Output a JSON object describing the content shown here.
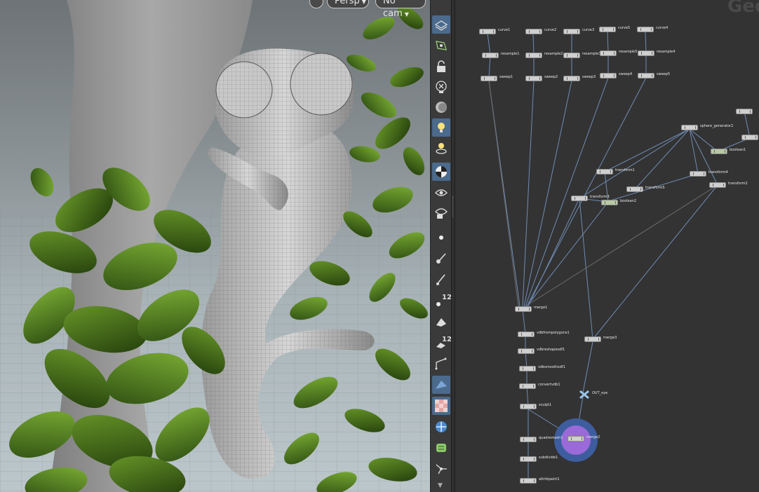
{
  "viewport": {
    "persp_label": "Persp",
    "cam_label": "No cam",
    "colors": {
      "leaf_dark": "#2e4a12",
      "leaf_light": "#6b9a2a",
      "model": "#b8b8b8",
      "bg": "#8d9598"
    }
  },
  "toolbar": {
    "tools": [
      {
        "name": "display-options-icon",
        "selected": true
      },
      {
        "name": "snapping-icon",
        "selected": false
      },
      {
        "name": "lock-icon",
        "selected": false
      },
      {
        "name": "x-ray-icon",
        "selected": false
      },
      {
        "name": "ghost-icon",
        "selected": false
      },
      {
        "name": "light-icon",
        "selected": true
      },
      {
        "name": "camera-light-icon",
        "selected": false
      },
      {
        "name": "shading-ball-icon",
        "selected": true
      },
      {
        "name": "eye-visibility-icon",
        "selected": false
      },
      {
        "name": "render-visibility-icon",
        "selected": false
      },
      {
        "name": "point-icon",
        "selected": false
      },
      {
        "name": "brush-icon",
        "selected": false
      },
      {
        "name": "pin-icon",
        "selected": false
      },
      {
        "name": "vertex-num-icon",
        "selected": false
      },
      {
        "name": "primitive-icon",
        "selected": false
      },
      {
        "name": "primitive-num-icon",
        "selected": false
      },
      {
        "name": "edge-icon",
        "selected": false
      },
      {
        "name": "face-shaded-icon",
        "selected": true
      },
      {
        "name": "checker-icon",
        "selected": true
      },
      {
        "name": "transform-icon",
        "selected": false
      },
      {
        "name": "uv-icon",
        "selected": false
      },
      {
        "name": "handle-icon",
        "selected": false
      }
    ],
    "num_12a": "12",
    "num_12b": "12"
  },
  "network": {
    "title": "Geo",
    "nodes": [
      {
        "id": "curve1",
        "label": "curve1"
      },
      {
        "id": "curve2",
        "label": "curve2"
      },
      {
        "id": "curve3",
        "label": "curve3"
      },
      {
        "id": "curve5",
        "label": "curve5"
      },
      {
        "id": "curve4",
        "label": "curve4"
      },
      {
        "id": "resample1",
        "label": "resample1"
      },
      {
        "id": "resample2",
        "label": "resample2"
      },
      {
        "id": "resample3",
        "label": "resample3"
      },
      {
        "id": "resample5",
        "label": "resample5"
      },
      {
        "id": "resample4",
        "label": "resample4"
      },
      {
        "id": "sweep1",
        "label": "sweep1"
      },
      {
        "id": "sweep2",
        "label": "sweep2"
      },
      {
        "id": "sweep3",
        "label": "sweep3"
      },
      {
        "id": "sweep4",
        "label": "sweep4"
      },
      {
        "id": "sweep5",
        "label": "sweep5"
      },
      {
        "id": "sphere_generator1",
        "label": "sphere_generator1"
      },
      {
        "id": "boolean1",
        "label": "boolean1"
      },
      {
        "id": "transform1",
        "label": "transform1"
      },
      {
        "id": "transform4",
        "label": "transform4"
      },
      {
        "id": "transform5",
        "label": "transform5"
      },
      {
        "id": "transform2",
        "label": "transform2"
      },
      {
        "id": "transform3",
        "label": "transform3"
      },
      {
        "id": "boolean2",
        "label": "boolean2"
      },
      {
        "id": "merge1",
        "label": "merge1"
      },
      {
        "id": "vdbfrompolygons1",
        "label": "vdbfrompolygons1"
      },
      {
        "id": "vdbreshapesdf1",
        "label": "vdbreshapesdf1"
      },
      {
        "id": "vdbsmoothsdf1",
        "label": "vdbsmoothsdf1"
      },
      {
        "id": "convertvdb1",
        "label": "convertvdb1"
      },
      {
        "id": "sculpt1",
        "label": "sculpt1"
      },
      {
        "id": "quadremesh1",
        "label": "quadremesh1"
      },
      {
        "id": "subdivide1",
        "label": "subdivide1"
      },
      {
        "id": "attribpaint1",
        "label": "attribpaint1"
      },
      {
        "id": "merge3",
        "label": "merge3"
      },
      {
        "id": "merge2",
        "label": "merge2"
      },
      {
        "id": "out_eye",
        "label": "OUT_eye"
      }
    ]
  }
}
